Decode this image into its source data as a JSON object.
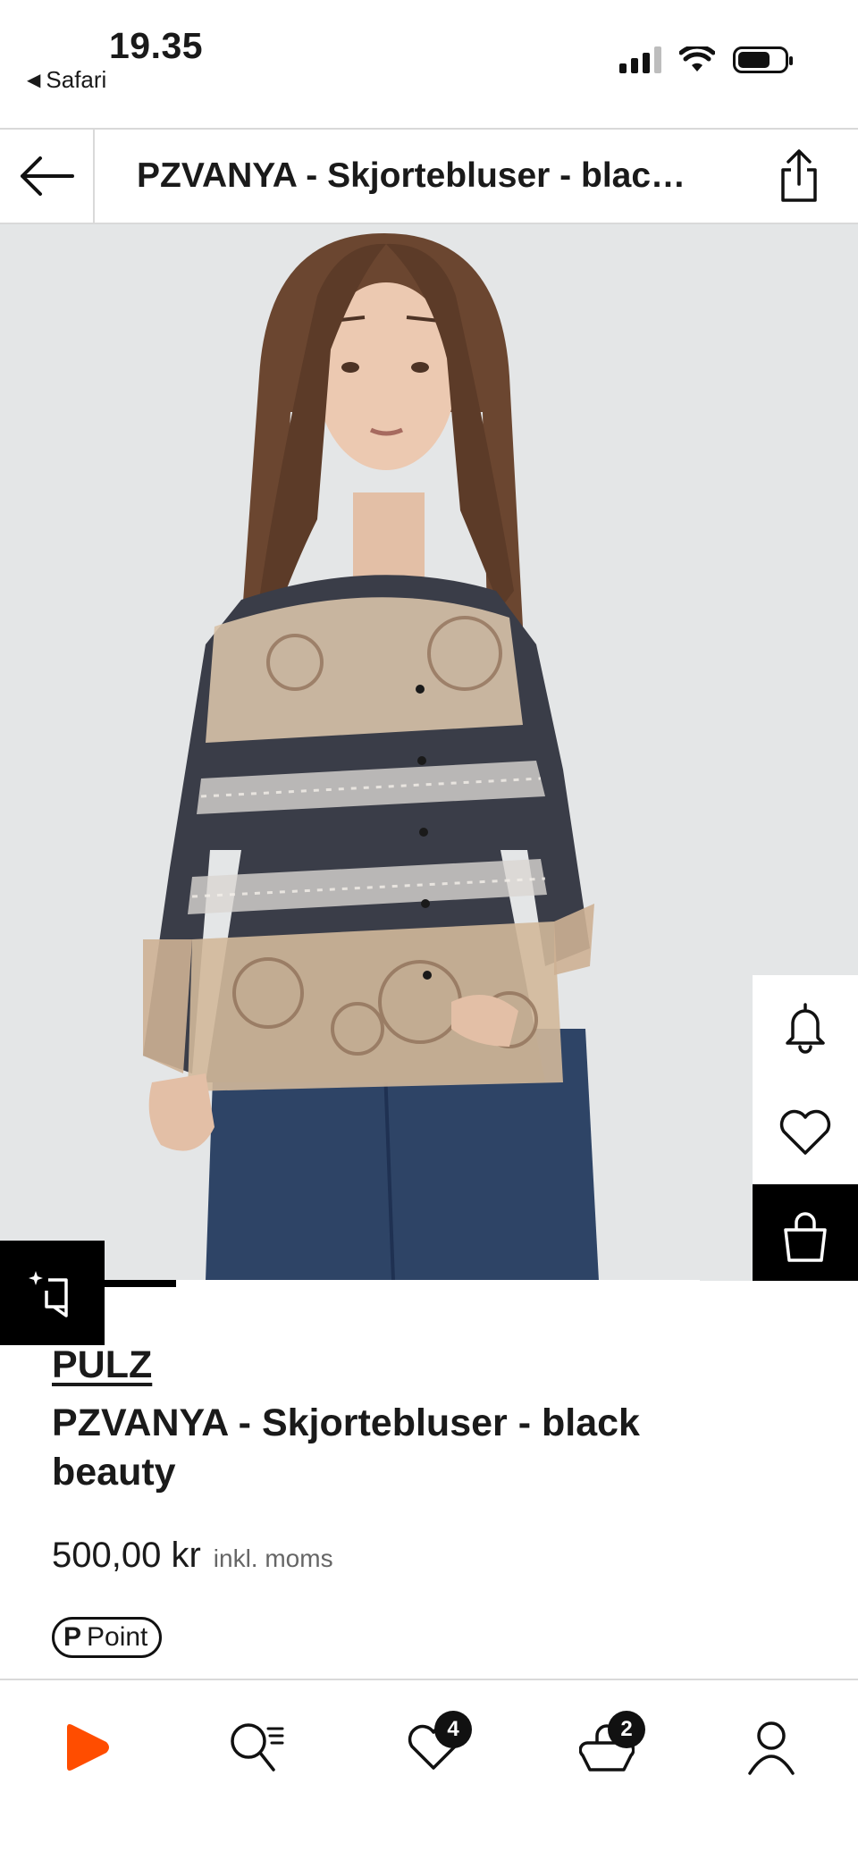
{
  "status_bar": {
    "time": "19.35",
    "back_app": "Safari",
    "back_glyph": "◀"
  },
  "header": {
    "title": "PZVANYA - Skjortebluser - blac…",
    "back_icon": "arrow-left-icon",
    "share_icon": "share-icon"
  },
  "product_image": {
    "side_actions": [
      "bell-icon",
      "heart-icon",
      "bag-icon"
    ],
    "similar_icon": "sparkle-crop-icon"
  },
  "product": {
    "brand": "PULZ",
    "name": "PZVANYA - Skjortebluser - black beauty",
    "price": "500,00 kr",
    "tax_note": "inkl. moms",
    "point_label": "Point",
    "point_glyph": "P"
  },
  "bottom_nav": {
    "items": [
      {
        "icon": "home-logo-icon",
        "badge": ""
      },
      {
        "icon": "search-list-icon",
        "badge": ""
      },
      {
        "icon": "wishlist-heart-icon",
        "badge": "4"
      },
      {
        "icon": "cart-bag-icon",
        "badge": "2"
      },
      {
        "icon": "profile-icon",
        "badge": ""
      }
    ]
  },
  "colors": {
    "brand_orange": "#ff4d00",
    "image_bg": "#e5e7e8",
    "text": "#1a1a1a"
  }
}
